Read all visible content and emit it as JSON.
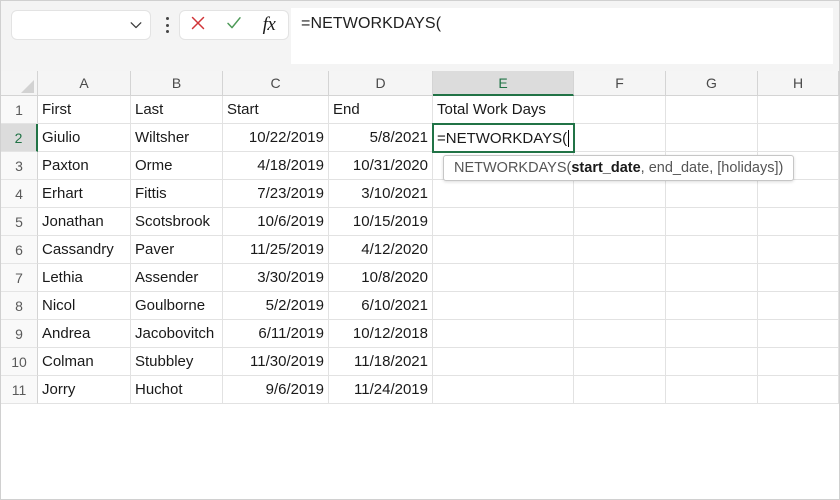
{
  "formula_bar": {
    "name_box_value": "",
    "name_box_placeholder": "",
    "chevron_icon": "chevron-down-icon",
    "kebab_icon": "more-options-icon",
    "cancel_icon": "cancel-x-icon",
    "confirm_icon": "confirm-check-icon",
    "fx_label": "fx",
    "formula_value": "=NETWORKDAYS(",
    "cancel_color": "#d13438",
    "confirm_color": "#4e9a58"
  },
  "grid": {
    "accent_color": "#217346",
    "columns": [
      "A",
      "B",
      "C",
      "D",
      "E",
      "F",
      "G",
      "H"
    ],
    "selected_column": "E",
    "rows": [
      "1",
      "2",
      "3",
      "4",
      "5",
      "6",
      "7",
      "8",
      "9",
      "10",
      "11"
    ],
    "selected_row": "2",
    "headers": {
      "A": "First",
      "B": "Last",
      "C": "Start",
      "D": "End",
      "E": "Total Work Days"
    },
    "data": [
      {
        "row": "2",
        "first": "Giulio",
        "last": "Wiltsher",
        "start": "10/22/2019",
        "end": "5/8/2021"
      },
      {
        "row": "3",
        "first": "Paxton",
        "last": "Orme",
        "start": "4/18/2019",
        "end": "10/31/2020"
      },
      {
        "row": "4",
        "first": "Erhart",
        "last": "Fittis",
        "start": "7/23/2019",
        "end": "3/10/2021"
      },
      {
        "row": "5",
        "first": "Jonathan",
        "last": "Scotsbrook",
        "start": "10/6/2019",
        "end": "10/15/2019"
      },
      {
        "row": "6",
        "first": "Cassandry",
        "last": "Paver",
        "start": "11/25/2019",
        "end": "4/12/2020"
      },
      {
        "row": "7",
        "first": "Lethia",
        "last": "Assender",
        "start": "3/30/2019",
        "end": "10/8/2020"
      },
      {
        "row": "8",
        "first": "Nicol",
        "last": "Goulborne",
        "start": "5/2/2019",
        "end": "6/10/2021"
      },
      {
        "row": "9",
        "first": "Andrea",
        "last": "Jacobovitch",
        "start": "6/11/2019",
        "end": "10/12/2018"
      },
      {
        "row": "10",
        "first": "Colman",
        "last": "Stubbley",
        "start": "11/30/2019",
        "end": "11/18/2021"
      },
      {
        "row": "11",
        "first": "Jorry",
        "last": "Huchot",
        "start": "9/6/2019",
        "end": "11/24/2019"
      }
    ],
    "active_cell": {
      "reference": "E2",
      "value": "=NETWORKDAYS("
    }
  },
  "tooltip": {
    "prefix": "NETWORKDAYS(",
    "bold_arg": "start_date",
    "suffix": ", end_date, [holidays])"
  }
}
